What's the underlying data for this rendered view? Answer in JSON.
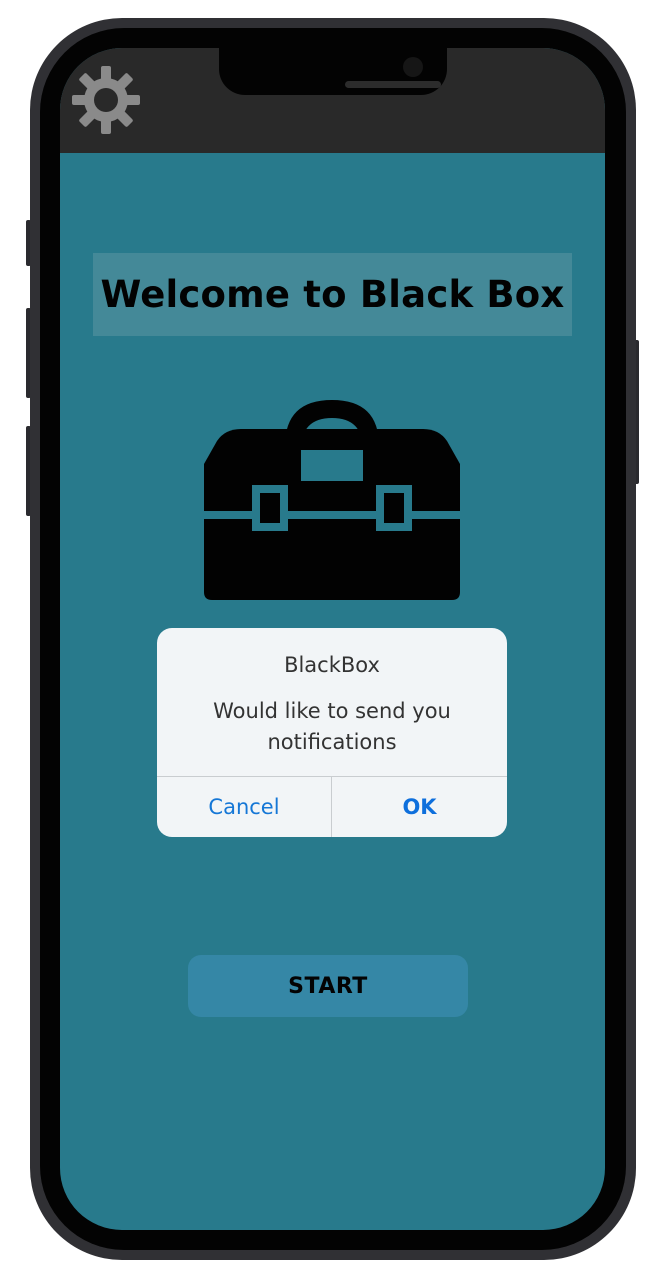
{
  "app": {
    "title": "Welcome to Black Box"
  },
  "header": {
    "settings_icon": "gear-icon"
  },
  "hero": {
    "icon": "toolbox-icon"
  },
  "alert": {
    "title": "BlackBox",
    "message": "Would like to send you notifications",
    "cancel_label": "Cancel",
    "ok_label": "OK"
  },
  "start_button": {
    "label": "START"
  },
  "colors": {
    "screen_background": "#287a8c",
    "title_banner": "#448998",
    "status_bar": "#292929",
    "alert_background": "#f2f5f7",
    "alert_button_text": "#1577d6",
    "start_button": "#3587a6",
    "gear": "#8a8a8a"
  }
}
